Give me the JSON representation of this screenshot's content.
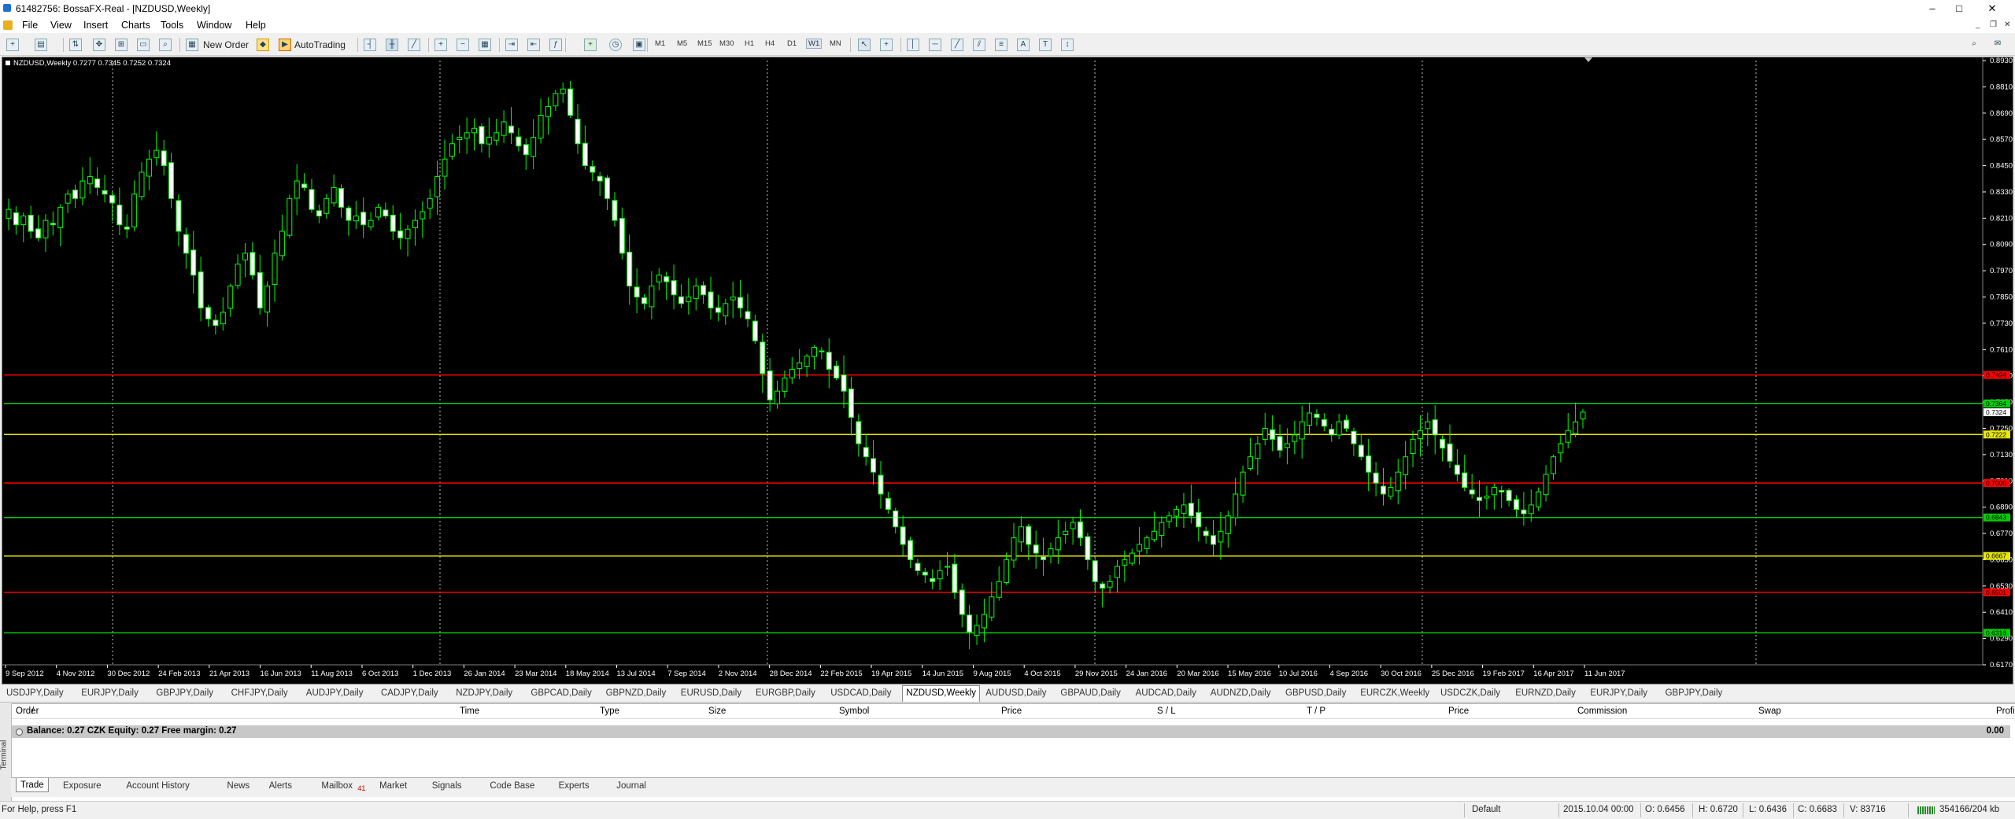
{
  "window": {
    "title": "61482756: BossaFX-Real - [NZDUSD,Weekly]",
    "min": "–",
    "max": "□",
    "close": "✕"
  },
  "menu": [
    "File",
    "View",
    "Insert",
    "Charts",
    "Tools",
    "Window",
    "Help"
  ],
  "toolbar": {
    "new_order": "New Order",
    "autotrading": "AutoTrading",
    "timeframes": [
      "M1",
      "M5",
      "M15",
      "M30",
      "H1",
      "H4",
      "D1",
      "W1",
      "MN"
    ],
    "active_timeframe": "W1"
  },
  "chart": {
    "symbol_info": "NZDUSD,Weekly  0.7277 0.7345 0.7252 0.7324",
    "price_labels": [
      "0.8930",
      "0.8810",
      "0.8690",
      "0.8570",
      "0.8450",
      "0.8330",
      "0.8210",
      "0.8090",
      "0.7970",
      "0.7850",
      "0.7730",
      "0.7610",
      "0.7490",
      "0.7370",
      "0.7250",
      "0.7130",
      "0.7010",
      "0.6890",
      "0.6770",
      "0.6650",
      "0.6530",
      "0.6410",
      "0.6290",
      "0.6170"
    ],
    "date_labels": [
      "9 Sep 2012",
      "4 Nov 2012",
      "30 Dec 2012",
      "24 Feb 2013",
      "21 Apr 2013",
      "16 Jun 2013",
      "11 Aug 2013",
      "6 Oct 2013",
      "1 Dec 2013",
      "26 Jan 2014",
      "23 Mar 2014",
      "18 May 2014",
      "13 Jul 2014",
      "7 Sep 2014",
      "2 Nov 2014",
      "28 Dec 2014",
      "22 Feb 2015",
      "19 Apr 2015",
      "14 Jun 2015",
      "9 Aug 2015",
      "4 Oct 2015",
      "29 Nov 2015",
      "24 Jan 2016",
      "20 Mar 2016",
      "15 May 2016",
      "10 Jul 2016",
      "4 Sep 2016",
      "30 Oct 2016",
      "25 Dec 2016",
      "19 Feb 2017",
      "16 Apr 2017",
      "11 Jun 2017"
    ],
    "current_price": "0.7324",
    "level_lines": [
      {
        "price": 0.7494,
        "color": "#ff0000",
        "tag": "0.7494"
      },
      {
        "price": 0.7364,
        "color": "#00d000",
        "tag": "0.7364"
      },
      {
        "price": 0.7222,
        "color": "#e8e800",
        "tag": "0.7222"
      },
      {
        "price": 0.7,
        "color": "#ff0000",
        "tag": "0.7000"
      },
      {
        "price": 0.6843,
        "color": "#00d000",
        "tag": "0.6843"
      },
      {
        "price": 0.6667,
        "color": "#e8e800",
        "tag": "0.6667"
      },
      {
        "price": 0.6501,
        "color": "#ff0000",
        "tag": "0.6501"
      },
      {
        "price": 0.6316,
        "color": "#00d000",
        "tag": "0.6316"
      }
    ],
    "colors": {
      "bull": "#00ff00",
      "bear": "#000000",
      "wick": "#00ff00",
      "grid": "#c0c0c0",
      "axis_text": "#ffffff"
    }
  },
  "chart_data": {
    "type": "candlestick",
    "title": "NZDUSD,Weekly",
    "ylim": [
      0.617,
      0.893
    ],
    "x_ticks": [
      "9 Sep 2012",
      "4 Nov 2012",
      "30 Dec 2012",
      "24 Feb 2013",
      "21 Apr 2013",
      "16 Jun 2013",
      "11 Aug 2013",
      "6 Oct 2013",
      "1 Dec 2013",
      "26 Jan 2014",
      "23 Mar 2014",
      "18 May 2014",
      "13 Jul 2014",
      "7 Sep 2014",
      "2 Nov 2014",
      "28 Dec 2014",
      "22 Feb 2015",
      "19 Apr 2015",
      "14 Jun 2015",
      "9 Aug 2015",
      "4 Oct 2015",
      "29 Nov 2015",
      "24 Jan 2016",
      "20 Mar 2016",
      "15 May 2016",
      "10 Jul 2016",
      "4 Sep 2016",
      "30 Oct 2016",
      "25 Dec 2016",
      "19 Feb 2017",
      "16 Apr 2017",
      "11 Jun 2017"
    ],
    "close_path": [
      0.825,
      0.818,
      0.822,
      0.815,
      0.812,
      0.82,
      0.818,
      0.826,
      0.832,
      0.83,
      0.838,
      0.84,
      0.835,
      0.832,
      0.828,
      0.818,
      0.816,
      0.832,
      0.842,
      0.848,
      0.852,
      0.845,
      0.83,
      0.815,
      0.805,
      0.795,
      0.78,
      0.775,
      0.772,
      0.778,
      0.79,
      0.8,
      0.805,
      0.795,
      0.78,
      0.79,
      0.805,
      0.815,
      0.83,
      0.838,
      0.835,
      0.825,
      0.822,
      0.83,
      0.835,
      0.826,
      0.82,
      0.822,
      0.818,
      0.82,
      0.826,
      0.822,
      0.815,
      0.812,
      0.816,
      0.82,
      0.824,
      0.83,
      0.84,
      0.848,
      0.855,
      0.858,
      0.86,
      0.862,
      0.855,
      0.858,
      0.86,
      0.865,
      0.86,
      0.854,
      0.85,
      0.858,
      0.868,
      0.872,
      0.878,
      0.88,
      0.868,
      0.855,
      0.845,
      0.842,
      0.838,
      0.83,
      0.82,
      0.805,
      0.79,
      0.785,
      0.782,
      0.79,
      0.795,
      0.792,
      0.786,
      0.782,
      0.785,
      0.79,
      0.786,
      0.78,
      0.778,
      0.782,
      0.785,
      0.78,
      0.775,
      0.765,
      0.75,
      0.738,
      0.742,
      0.748,
      0.752,
      0.755,
      0.758,
      0.762,
      0.76,
      0.752,
      0.748,
      0.742,
      0.73,
      0.718,
      0.712,
      0.705,
      0.695,
      0.688,
      0.68,
      0.672,
      0.665,
      0.66,
      0.658,
      0.655,
      0.66,
      0.662,
      0.65,
      0.64,
      0.632,
      0.635,
      0.64,
      0.648,
      0.655,
      0.665,
      0.675,
      0.68,
      0.672,
      0.668,
      0.665,
      0.67,
      0.675,
      0.678,
      0.682,
      0.675,
      0.665,
      0.655,
      0.652,
      0.655,
      0.662,
      0.665,
      0.668,
      0.672,
      0.675,
      0.678,
      0.682,
      0.685,
      0.688,
      0.69,
      0.685,
      0.68,
      0.676,
      0.672,
      0.678,
      0.685,
      0.695,
      0.705,
      0.712,
      0.718,
      0.725,
      0.72,
      0.715,
      0.718,
      0.722,
      0.728,
      0.732,
      0.73,
      0.726,
      0.722,
      0.728,
      0.725,
      0.718,
      0.712,
      0.705,
      0.7,
      0.695,
      0.698,
      0.705,
      0.712,
      0.72,
      0.724,
      0.728,
      0.722,
      0.716,
      0.71,
      0.704,
      0.698,
      0.695,
      0.692,
      0.694,
      0.698,
      0.696,
      0.692,
      0.688,
      0.686,
      0.69,
      0.696,
      0.704,
      0.712,
      0.718,
      0.724,
      0.728,
      0.7324
    ]
  },
  "chart_tabs": [
    "USDJPY,Daily",
    "EURJPY,Daily",
    "GBPJPY,Daily",
    "CHFJPY,Daily",
    "AUDJPY,Daily",
    "CADJPY,Daily",
    "NZDJPY,Daily",
    "GBPCAD,Daily",
    "GBPNZD,Daily",
    "EURUSD,Daily",
    "EURGBP,Daily",
    "USDCAD,Daily",
    "NZDUSD,Weekly",
    "AUDUSD,Daily",
    "GBPAUD,Daily",
    "AUDCAD,Daily",
    "AUDNZD,Daily",
    "GBPUSD,Daily",
    "EURCZK,Weekly",
    "USDCZK,Daily",
    "EURNZD,Daily",
    "EURJPY,Daily",
    "GBPJPY,Daily"
  ],
  "active_chart_tab": "NZDUSD,Weekly",
  "terminal": {
    "side_label": "Terminal",
    "columns": [
      "Order",
      "/",
      "Time",
      "Type",
      "Size",
      "Symbol",
      "Price",
      "S / L",
      "T / P",
      "Price",
      "Commission",
      "Swap",
      "Profit"
    ],
    "balance_text": "Balance: 0.27 CZK  Equity: 0.27  Free margin: 0.27",
    "balance_profit": "0.00",
    "tabs": [
      "Trade",
      "Exposure",
      "Account History",
      "News",
      "Alerts",
      "Mailbox",
      "Market",
      "Signals",
      "Code Base",
      "Experts",
      "Journal"
    ],
    "mailbox_badge": "41",
    "active_tab": "Trade"
  },
  "status": {
    "help": "For Help, press F1",
    "profile": "Default",
    "datetime": "2015.10.04 00:00",
    "open": "O: 0.6456",
    "high": "H: 0.6720",
    "low": "L: 0.6436",
    "close": "C: 0.6683",
    "volume": "V: 83716",
    "traffic": "354166/204 kb"
  }
}
